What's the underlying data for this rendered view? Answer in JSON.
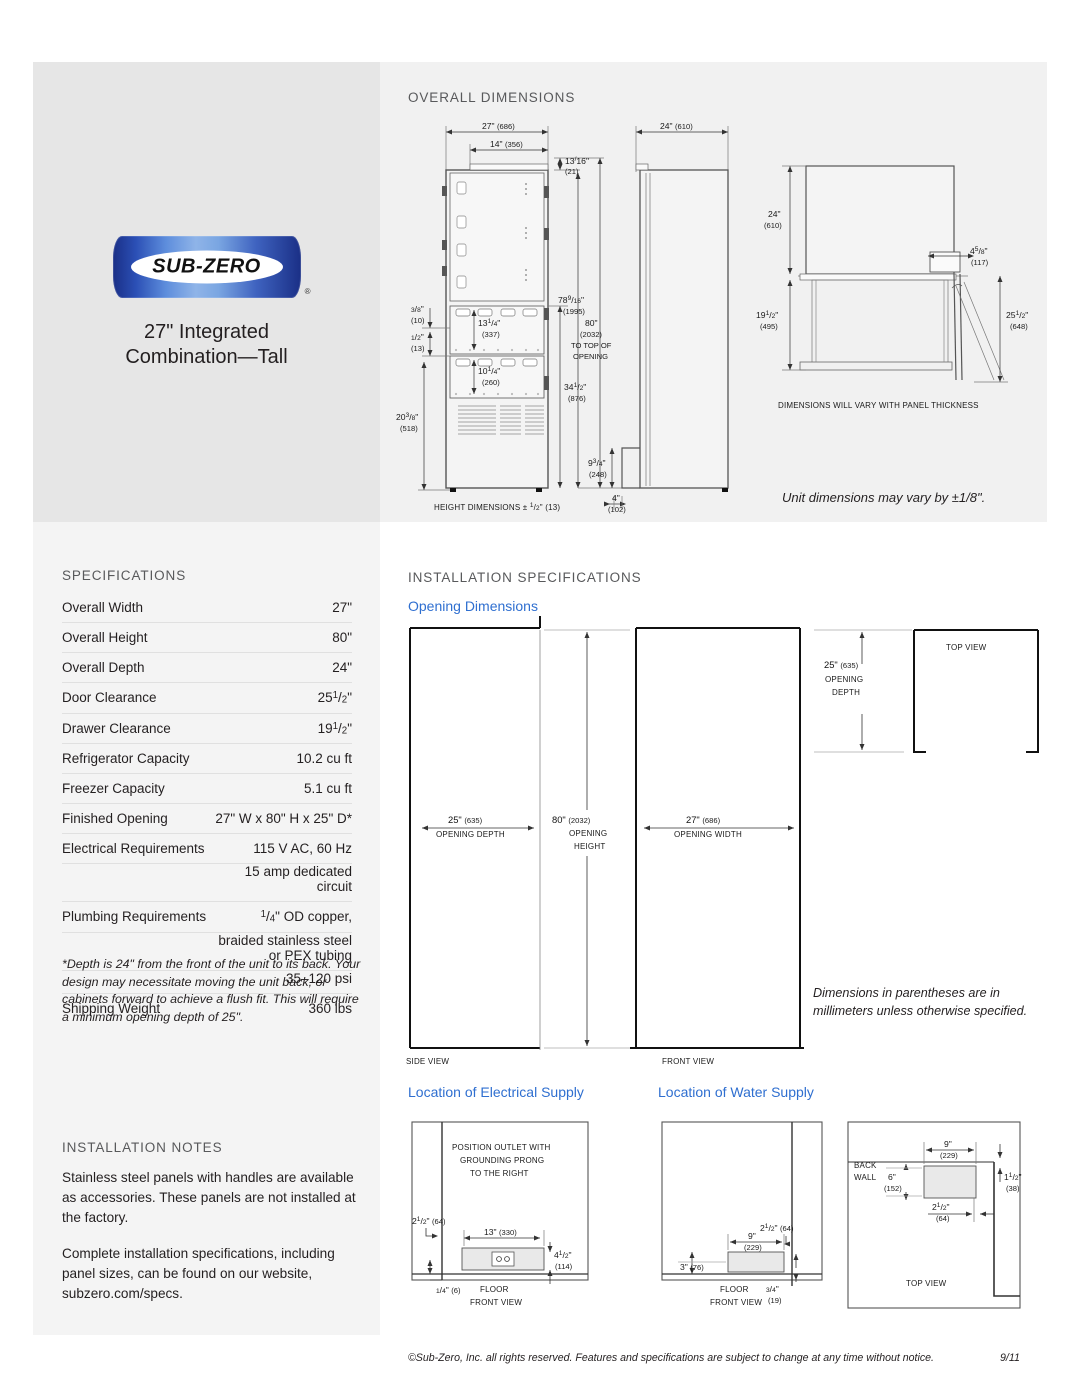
{
  "brand": {
    "logo_text": "SUB-ZERO",
    "registered_mark": "®",
    "product_title_line1": "27\" Integrated",
    "product_title_line2": "Combination—Tall"
  },
  "headings": {
    "overall_dimensions": "OVERALL DIMENSIONS",
    "specifications": "SPECIFICATIONS",
    "installation_specifications": "INSTALLATION SPECIFICATIONS",
    "opening_dimensions": "Opening Dimensions",
    "location_electrical": "Location of Electrical Supply",
    "location_water": "Location of Water Supply",
    "installation_notes": "INSTALLATION NOTES"
  },
  "specifications": {
    "rows": [
      {
        "label": "Overall Width",
        "value": "27\""
      },
      {
        "label": "Overall Height",
        "value": "80\""
      },
      {
        "label": "Overall Depth",
        "value": "24\""
      },
      {
        "label": "Door Clearance",
        "value": "25",
        "frac_num": "1",
        "frac_den": "2",
        "suffix": "\""
      },
      {
        "label": "Drawer Clearance",
        "value": "19",
        "frac_num": "1",
        "frac_den": "2",
        "suffix": "\""
      },
      {
        "label": "Refrigerator Capacity",
        "value": "10.2 cu ft"
      },
      {
        "label": "Freezer Capacity",
        "value": "5.1 cu ft"
      },
      {
        "label": "Finished Opening",
        "value": "27\" W x 80\" H x 25\" D*"
      },
      {
        "label": "Electrical Requirements",
        "value": "115 V AC, 60 Hz"
      },
      {
        "label": "",
        "value": "15 amp dedicated circuit"
      },
      {
        "label": "Plumbing Requirements",
        "value": "OD copper,",
        "frac_num": "1",
        "frac_den": "4",
        "prefix_frac": true,
        "suffix": "\""
      },
      {
        "label": "",
        "value": "braided stainless steel or PEX tubing"
      },
      {
        "label": "",
        "value": "35–120 psi"
      },
      {
        "label": "Shipping Weight",
        "value": "360 lbs"
      }
    ]
  },
  "footnote": "*Depth is 24\" from the front of the unit to its back. Your design may necessitate moving the unit back, or cabinets forward to achieve a flush fit. This will require a minimum opening depth of 25\".",
  "installation_notes": {
    "p1": "Stainless steel panels with handles are available as accessories. These panels are not installed at the factory.",
    "p2": "Complete installation specifications, including panel sizes, can be found on our website, subzero.com/specs."
  },
  "notes": {
    "unit_vary": "Unit dimensions may vary by ±1/8\".",
    "millimeters": "Dimensions in parentheses are in millimeters unless otherwise specified.",
    "panel_thickness": "DIMENSIONS WILL VARY WITH PANEL THICKNESS",
    "height_tolerance": "HEIGHT DIMENSIONS ± 1/2\" (13)"
  },
  "overall_dimensions": {
    "front_view": {
      "width_total": {
        "inches": "27\"",
        "mm": "(686)"
      },
      "width_door": {
        "inches": "14\"",
        "mm": "(356)"
      },
      "top_gap": {
        "whole": "",
        "frac_num": "13",
        "frac_den": "16",
        "suffix": "\"",
        "mm": "(21)"
      },
      "door_height": {
        "whole": "78",
        "frac_num": "9",
        "frac_den": "16",
        "suffix": "\"",
        "mm": "(1995)"
      },
      "opening_height": {
        "inches": "80\"",
        "mm": "(2032)",
        "note1": "TO TOP OF",
        "note2": "OPENING"
      },
      "left_top_offset": {
        "frac_num": "3",
        "frac_den": "8",
        "suffix": "\"",
        "mm": "(10)"
      },
      "gap_half": {
        "frac_num": "1",
        "frac_den": "2",
        "suffix": "\"",
        "mm": "(13)"
      },
      "upper_drawer": {
        "whole": "13",
        "frac_num": "1",
        "frac_den": "4",
        "suffix": "\"",
        "mm": "(337)"
      },
      "lower_drawer": {
        "whole": "10",
        "frac_num": "1",
        "frac_den": "4",
        "suffix": "\"",
        "mm": "(260)"
      },
      "base_height": {
        "whole": "20",
        "frac_num": "3",
        "frac_den": "8",
        "suffix": "\"",
        "mm": "(518)"
      },
      "drawer_section": {
        "whole": "34",
        "frac_num": "1",
        "frac_den": "2",
        "suffix": "\"",
        "mm": "(876)"
      },
      "grille_height": {
        "whole": "9",
        "frac_num": "3",
        "frac_den": "4",
        "suffix": "\"",
        "mm": "(248)"
      },
      "toe_depth": {
        "inches": "4\"",
        "mm": "(102)"
      }
    },
    "side_view": {
      "depth": {
        "inches": "24\"",
        "mm": "(610)"
      }
    },
    "top_view": {
      "depth": {
        "inches": "24\"",
        "mm": "(610)"
      },
      "handle_proj": {
        "whole": "4",
        "frac_num": "5",
        "frac_den": "8",
        "suffix": "\"",
        "mm": "(117)"
      },
      "drawer_clear": {
        "whole": "19",
        "frac_num": "1",
        "frac_den": "2",
        "suffix": "\"",
        "mm": "(495)"
      },
      "door_clear": {
        "whole": "25",
        "frac_num": "1",
        "frac_den": "2",
        "suffix": "\"",
        "mm": "(648)"
      }
    }
  },
  "opening_dimensions": {
    "opening_depth": {
      "inches": "25\"",
      "mm": "(635)",
      "label": "OPENING DEPTH"
    },
    "opening_height": {
      "inches": "80\"",
      "mm": "(2032)",
      "label1": "OPENING",
      "label2": "HEIGHT"
    },
    "opening_width": {
      "inches": "27\"",
      "mm": "(686)",
      "label": "OPENING WIDTH"
    },
    "top_depth": {
      "inches": "25\"",
      "mm": "(635)",
      "label1": "OPENING",
      "label2": "DEPTH"
    },
    "view_side": "SIDE VIEW",
    "view_front": "FRONT VIEW",
    "view_top": "TOP VIEW"
  },
  "electrical_supply": {
    "note1": "POSITION OUTLET WITH",
    "note2": "GROUNDING PRONG",
    "note3": "TO THE RIGHT",
    "left_offset": {
      "whole": "2",
      "frac_num": "1",
      "frac_den": "2",
      "suffix": "\"",
      "mm": "(64)"
    },
    "width": {
      "inches": "13\"",
      "mm": "(330)"
    },
    "height": {
      "whole": "4",
      "frac_num": "1",
      "frac_den": "2",
      "suffix": "\"",
      "mm": "(114)"
    },
    "bottom_offset": {
      "frac_num": "1",
      "frac_den": "4",
      "suffix": "\"",
      "mm": "(6)"
    },
    "floor_label": "FLOOR",
    "view_label": "FRONT VIEW"
  },
  "water_supply": {
    "right_offset": {
      "whole": "2",
      "frac_num": "1",
      "frac_den": "2",
      "suffix": "\"",
      "mm": "(64)"
    },
    "width": {
      "inches": "9\"",
      "mm": "(229)"
    },
    "left_offset": {
      "inches": "3\"",
      "mm": "(76)"
    },
    "bottom_offset": {
      "frac_num": "3",
      "frac_den": "4",
      "suffix": "\"",
      "mm": "(19)"
    },
    "floor_label": "FLOOR",
    "view_label": "FRONT VIEW"
  },
  "water_top_view": {
    "back_wall_label1": "BACK",
    "back_wall_label2": "WALL",
    "width": {
      "inches": "9\"",
      "mm": "(229)"
    },
    "depth": {
      "inches": "6\"",
      "mm": "(152)"
    },
    "offset": {
      "whole": "2",
      "frac_num": "1",
      "frac_den": "2",
      "suffix": "\"",
      "mm": "(64)"
    },
    "side_gap": {
      "whole": "1",
      "frac_num": "1",
      "frac_den": "2",
      "suffix": "\"",
      "mm": "(38)"
    },
    "view_label": "TOP VIEW"
  },
  "footer": {
    "copyright": "©Sub-Zero, Inc. all rights reserved. Features and specifications are subject to change at any time without notice.",
    "date_code": "9/11"
  },
  "colors": {
    "accent_blue": "#2f6fd0",
    "logo_blue": "#1a2f86",
    "panel_gray": "#e6e6e6",
    "text": "#231f20"
  }
}
